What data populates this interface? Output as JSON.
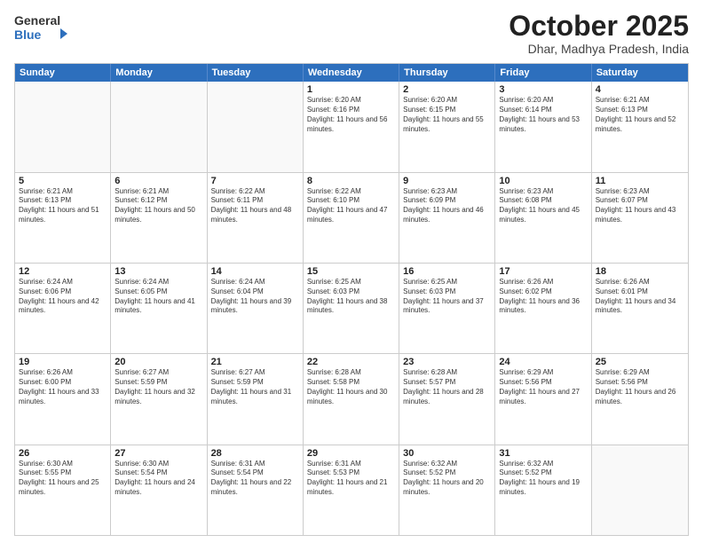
{
  "logo": {
    "general": "General",
    "blue": "Blue"
  },
  "title": "October 2025",
  "location": "Dhar, Madhya Pradesh, India",
  "weekdays": [
    "Sunday",
    "Monday",
    "Tuesday",
    "Wednesday",
    "Thursday",
    "Friday",
    "Saturday"
  ],
  "weeks": [
    [
      {
        "day": "",
        "empty": true
      },
      {
        "day": "",
        "empty": true
      },
      {
        "day": "",
        "empty": true
      },
      {
        "day": "1",
        "sunrise": "Sunrise: 6:20 AM",
        "sunset": "Sunset: 6:16 PM",
        "daylight": "Daylight: 11 hours and 56 minutes."
      },
      {
        "day": "2",
        "sunrise": "Sunrise: 6:20 AM",
        "sunset": "Sunset: 6:15 PM",
        "daylight": "Daylight: 11 hours and 55 minutes."
      },
      {
        "day": "3",
        "sunrise": "Sunrise: 6:20 AM",
        "sunset": "Sunset: 6:14 PM",
        "daylight": "Daylight: 11 hours and 53 minutes."
      },
      {
        "day": "4",
        "sunrise": "Sunrise: 6:21 AM",
        "sunset": "Sunset: 6:13 PM",
        "daylight": "Daylight: 11 hours and 52 minutes."
      }
    ],
    [
      {
        "day": "5",
        "sunrise": "Sunrise: 6:21 AM",
        "sunset": "Sunset: 6:13 PM",
        "daylight": "Daylight: 11 hours and 51 minutes."
      },
      {
        "day": "6",
        "sunrise": "Sunrise: 6:21 AM",
        "sunset": "Sunset: 6:12 PM",
        "daylight": "Daylight: 11 hours and 50 minutes."
      },
      {
        "day": "7",
        "sunrise": "Sunrise: 6:22 AM",
        "sunset": "Sunset: 6:11 PM",
        "daylight": "Daylight: 11 hours and 48 minutes."
      },
      {
        "day": "8",
        "sunrise": "Sunrise: 6:22 AM",
        "sunset": "Sunset: 6:10 PM",
        "daylight": "Daylight: 11 hours and 47 minutes."
      },
      {
        "day": "9",
        "sunrise": "Sunrise: 6:23 AM",
        "sunset": "Sunset: 6:09 PM",
        "daylight": "Daylight: 11 hours and 46 minutes."
      },
      {
        "day": "10",
        "sunrise": "Sunrise: 6:23 AM",
        "sunset": "Sunset: 6:08 PM",
        "daylight": "Daylight: 11 hours and 45 minutes."
      },
      {
        "day": "11",
        "sunrise": "Sunrise: 6:23 AM",
        "sunset": "Sunset: 6:07 PM",
        "daylight": "Daylight: 11 hours and 43 minutes."
      }
    ],
    [
      {
        "day": "12",
        "sunrise": "Sunrise: 6:24 AM",
        "sunset": "Sunset: 6:06 PM",
        "daylight": "Daylight: 11 hours and 42 minutes."
      },
      {
        "day": "13",
        "sunrise": "Sunrise: 6:24 AM",
        "sunset": "Sunset: 6:05 PM",
        "daylight": "Daylight: 11 hours and 41 minutes."
      },
      {
        "day": "14",
        "sunrise": "Sunrise: 6:24 AM",
        "sunset": "Sunset: 6:04 PM",
        "daylight": "Daylight: 11 hours and 39 minutes."
      },
      {
        "day": "15",
        "sunrise": "Sunrise: 6:25 AM",
        "sunset": "Sunset: 6:03 PM",
        "daylight": "Daylight: 11 hours and 38 minutes."
      },
      {
        "day": "16",
        "sunrise": "Sunrise: 6:25 AM",
        "sunset": "Sunset: 6:03 PM",
        "daylight": "Daylight: 11 hours and 37 minutes."
      },
      {
        "day": "17",
        "sunrise": "Sunrise: 6:26 AM",
        "sunset": "Sunset: 6:02 PM",
        "daylight": "Daylight: 11 hours and 36 minutes."
      },
      {
        "day": "18",
        "sunrise": "Sunrise: 6:26 AM",
        "sunset": "Sunset: 6:01 PM",
        "daylight": "Daylight: 11 hours and 34 minutes."
      }
    ],
    [
      {
        "day": "19",
        "sunrise": "Sunrise: 6:26 AM",
        "sunset": "Sunset: 6:00 PM",
        "daylight": "Daylight: 11 hours and 33 minutes."
      },
      {
        "day": "20",
        "sunrise": "Sunrise: 6:27 AM",
        "sunset": "Sunset: 5:59 PM",
        "daylight": "Daylight: 11 hours and 32 minutes."
      },
      {
        "day": "21",
        "sunrise": "Sunrise: 6:27 AM",
        "sunset": "Sunset: 5:59 PM",
        "daylight": "Daylight: 11 hours and 31 minutes."
      },
      {
        "day": "22",
        "sunrise": "Sunrise: 6:28 AM",
        "sunset": "Sunset: 5:58 PM",
        "daylight": "Daylight: 11 hours and 30 minutes."
      },
      {
        "day": "23",
        "sunrise": "Sunrise: 6:28 AM",
        "sunset": "Sunset: 5:57 PM",
        "daylight": "Daylight: 11 hours and 28 minutes."
      },
      {
        "day": "24",
        "sunrise": "Sunrise: 6:29 AM",
        "sunset": "Sunset: 5:56 PM",
        "daylight": "Daylight: 11 hours and 27 minutes."
      },
      {
        "day": "25",
        "sunrise": "Sunrise: 6:29 AM",
        "sunset": "Sunset: 5:56 PM",
        "daylight": "Daylight: 11 hours and 26 minutes."
      }
    ],
    [
      {
        "day": "26",
        "sunrise": "Sunrise: 6:30 AM",
        "sunset": "Sunset: 5:55 PM",
        "daylight": "Daylight: 11 hours and 25 minutes."
      },
      {
        "day": "27",
        "sunrise": "Sunrise: 6:30 AM",
        "sunset": "Sunset: 5:54 PM",
        "daylight": "Daylight: 11 hours and 24 minutes."
      },
      {
        "day": "28",
        "sunrise": "Sunrise: 6:31 AM",
        "sunset": "Sunset: 5:54 PM",
        "daylight": "Daylight: 11 hours and 22 minutes."
      },
      {
        "day": "29",
        "sunrise": "Sunrise: 6:31 AM",
        "sunset": "Sunset: 5:53 PM",
        "daylight": "Daylight: 11 hours and 21 minutes."
      },
      {
        "day": "30",
        "sunrise": "Sunrise: 6:32 AM",
        "sunset": "Sunset: 5:52 PM",
        "daylight": "Daylight: 11 hours and 20 minutes."
      },
      {
        "day": "31",
        "sunrise": "Sunrise: 6:32 AM",
        "sunset": "Sunset: 5:52 PM",
        "daylight": "Daylight: 11 hours and 19 minutes."
      },
      {
        "day": "",
        "empty": true
      }
    ]
  ]
}
